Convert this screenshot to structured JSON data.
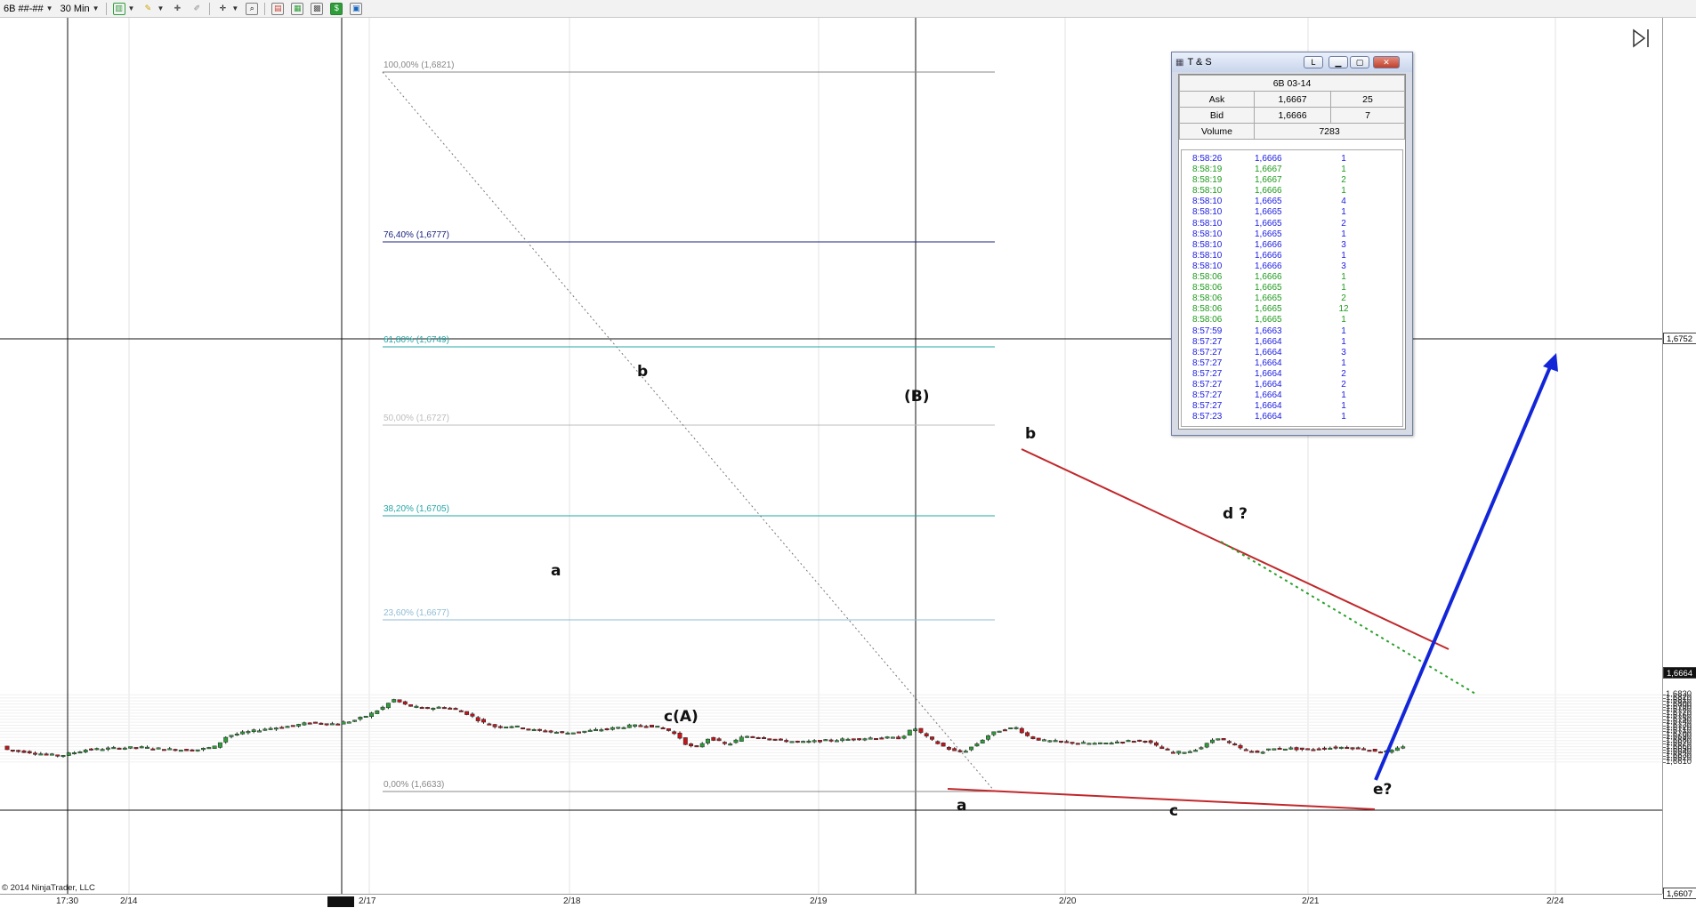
{
  "toolbar": {
    "instrument": "6B ##-##",
    "interval": "30 Min",
    "buttons": [
      "bar-type-icon",
      "pencil-icon",
      "crosshair-icon",
      "zoom-icon",
      "layout-icon",
      "properties-icon",
      "data-box-icon",
      "dollar-icon",
      "template-icon"
    ]
  },
  "chart": {
    "copyright": "© 2014 NinjaTrader, LLC",
    "price_labels": [
      "1,6830",
      "1,6820",
      "1,6810",
      "1,6800",
      "1,6790",
      "1,6780",
      "1,6770",
      "1,6760",
      "1,6750",
      "1,6740",
      "1,6730",
      "1,6720",
      "1,6710",
      "1,6700",
      "1,6690",
      "1,6680",
      "1,6670",
      "1,6660",
      "1,6650",
      "1,6640",
      "1,6630",
      "1,6620",
      "1,6610"
    ],
    "price_marker_top": "1,6752",
    "price_marker_current": "1,6664",
    "price_marker_bottom": "1,6607",
    "time_labels": [
      {
        "text": "17:30",
        "dark": false
      },
      {
        "text": "2/14",
        "dark": false
      },
      {
        "text": "2/17",
        "dark": false
      },
      {
        "text": "2/18",
        "dark": false
      },
      {
        "text": "2/19",
        "dark": false
      },
      {
        "text": "2/20",
        "dark": false
      },
      {
        "text": "2/21",
        "dark": false
      },
      {
        "text": "2/24",
        "dark": false
      }
    ],
    "fib_levels": [
      {
        "label": "100,00% (1,6821)",
        "color": "#888888"
      },
      {
        "label": "76,40% (1,6777)",
        "color": "#1a237e"
      },
      {
        "label": "61,80% (1,6749)",
        "color": "#26a6a6"
      },
      {
        "label": "50,00% (1,6727)",
        "color": "#bdbdbd"
      },
      {
        "label": "38,20% (1,6705)",
        "color": "#26a6a6"
      },
      {
        "label": "23,60% (1,6677)",
        "color": "#8fbcd4"
      },
      {
        "label": "0,00% (1,6633)",
        "color": "#888888"
      }
    ],
    "annotations": [
      "a",
      "b",
      "c(A)",
      "(B)",
      "b",
      "d ?",
      "a",
      "c",
      "e?"
    ],
    "colors": {
      "up_candle": "#2e9e3a",
      "down_candle": "#c4151c",
      "trendline": "#c0282b",
      "arrow": "#1226d8",
      "dotted_green": "#2aa02a"
    }
  },
  "ts": {
    "title": "T & S",
    "instrument": "6B 03-14",
    "ask_label": "Ask",
    "ask_price": "1,6667",
    "ask_size": "25",
    "bid_label": "Bid",
    "bid_price": "1,6666",
    "bid_size": "7",
    "volume_label": "Volume",
    "volume": "7283",
    "btn_l": "L",
    "rows": [
      {
        "time": "8:58:26",
        "price": "1,6666",
        "size": "1",
        "color": "#1a1ae0"
      },
      {
        "time": "8:58:19",
        "price": "1,6667",
        "size": "1",
        "color": "#1e9a1e"
      },
      {
        "time": "8:58:19",
        "price": "1,6667",
        "size": "2",
        "color": "#1e9a1e"
      },
      {
        "time": "8:58:10",
        "price": "1,6666",
        "size": "1",
        "color": "#1e9a1e"
      },
      {
        "time": "8:58:10",
        "price": "1,6665",
        "size": "4",
        "color": "#1a1ae0"
      },
      {
        "time": "8:58:10",
        "price": "1,6665",
        "size": "1",
        "color": "#1a1ae0"
      },
      {
        "time": "8:58:10",
        "price": "1,6665",
        "size": "2",
        "color": "#1a1ae0"
      },
      {
        "time": "8:58:10",
        "price": "1,6665",
        "size": "1",
        "color": "#1a1ae0"
      },
      {
        "time": "8:58:10",
        "price": "1,6666",
        "size": "3",
        "color": "#1a1ae0"
      },
      {
        "time": "8:58:10",
        "price": "1,6666",
        "size": "1",
        "color": "#1a1ae0"
      },
      {
        "time": "8:58:10",
        "price": "1,6666",
        "size": "3",
        "color": "#1a1ae0"
      },
      {
        "time": "8:58:06",
        "price": "1,6666",
        "size": "1",
        "color": "#1e9a1e"
      },
      {
        "time": "8:58:06",
        "price": "1,6665",
        "size": "1",
        "color": "#1e9a1e"
      },
      {
        "time": "8:58:06",
        "price": "1,6665",
        "size": "2",
        "color": "#1e9a1e"
      },
      {
        "time": "8:58:06",
        "price": "1,6665",
        "size": "12",
        "color": "#1e9a1e"
      },
      {
        "time": "8:58:06",
        "price": "1,6665",
        "size": "1",
        "color": "#1e9a1e"
      },
      {
        "time": "8:57:59",
        "price": "1,6663",
        "size": "1",
        "color": "#1a1ae0"
      },
      {
        "time": "8:57:27",
        "price": "1,6664",
        "size": "1",
        "color": "#1a1ae0"
      },
      {
        "time": "8:57:27",
        "price": "1,6664",
        "size": "3",
        "color": "#1a1ae0"
      },
      {
        "time": "8:57:27",
        "price": "1,6664",
        "size": "1",
        "color": "#1a1ae0"
      },
      {
        "time": "8:57:27",
        "price": "1,6664",
        "size": "2",
        "color": "#1a1ae0"
      },
      {
        "time": "8:57:27",
        "price": "1,6664",
        "size": "2",
        "color": "#1a1ae0"
      },
      {
        "time": "8:57:27",
        "price": "1,6664",
        "size": "1",
        "color": "#1a1ae0"
      },
      {
        "time": "8:57:27",
        "price": "1,6664",
        "size": "1",
        "color": "#1a1ae0"
      },
      {
        "time": "8:57:23",
        "price": "1,6664",
        "size": "1",
        "color": "#1a1ae0"
      }
    ]
  }
}
